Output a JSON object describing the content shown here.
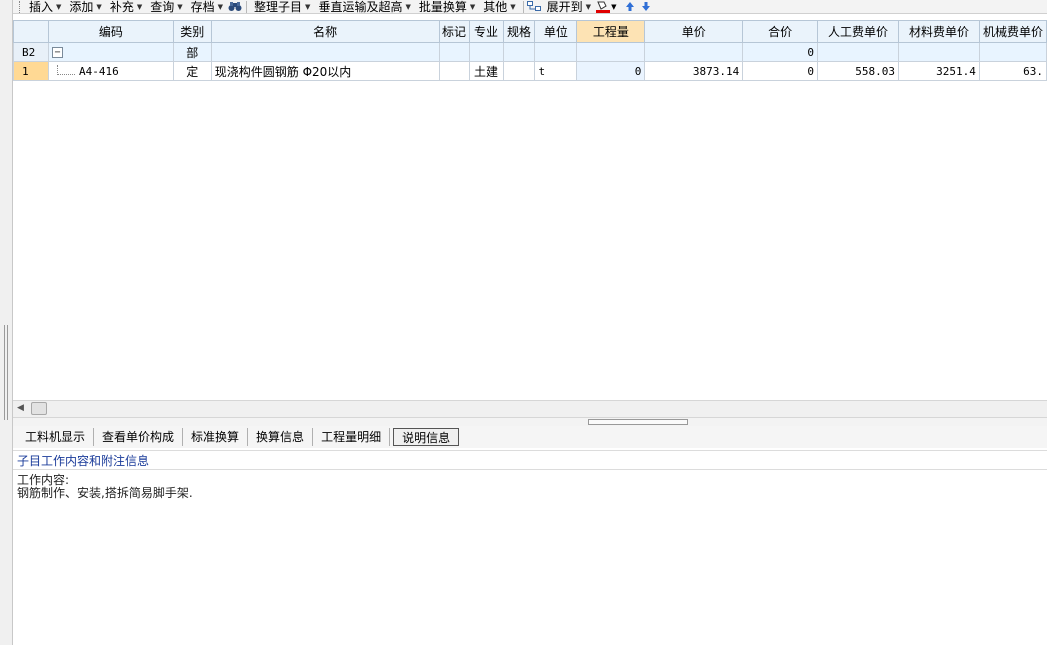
{
  "toolbar": {
    "items": [
      {
        "label": "插入",
        "dropdown": true
      },
      {
        "label": "添加",
        "dropdown": true
      },
      {
        "label": "补充",
        "dropdown": true
      },
      {
        "label": "查询",
        "dropdown": true
      },
      {
        "label": "存档",
        "dropdown": true
      }
    ],
    "find_icon": "binoculars-icon",
    "items2": [
      {
        "label": "整理子目",
        "dropdown": true
      },
      {
        "label": "垂直运输及超高",
        "dropdown": true
      },
      {
        "label": "批量换算",
        "dropdown": true
      },
      {
        "label": "其他",
        "dropdown": true
      }
    ],
    "expand_label": "展开到",
    "expand_icon": "expand-tree-icon",
    "color_icon": "paint-bucket-icon",
    "up_icon": "arrow-up-icon",
    "down_icon": "arrow-down-icon"
  },
  "grid": {
    "columns": [
      "",
      "编码",
      "类别",
      "名称",
      "标记",
      "专业",
      "规格",
      "单位",
      "工程量",
      "单价",
      "合价",
      "人工费单价",
      "材料费单价",
      "机械费单价"
    ],
    "rows": [
      {
        "rownum": "B2",
        "code": "",
        "type": "部",
        "name": "",
        "mark": "",
        "spec_major": "",
        "spec": "",
        "unit": "",
        "qty": "",
        "price": "",
        "total": "0",
        "labor": "",
        "material": "",
        "machine": ""
      },
      {
        "rownum": "1",
        "code": "A4-416",
        "type": "定",
        "name": "现浇构件圆钢筋 Φ20以内",
        "mark": "",
        "spec_major": "土建",
        "spec": "",
        "unit": "t",
        "qty": "0",
        "price": "3873.14",
        "total": "0",
        "labor": "558.03",
        "material": "3251.4",
        "machine": "63."
      }
    ]
  },
  "bottom_tabs": [
    "工料机显示",
    "查看单价构成",
    "标准换算",
    "换算信息",
    "工程量明细",
    "说明信息"
  ],
  "info": {
    "title": "子目工作内容和附注信息",
    "line1": "工作内容:",
    "line2": "钢筋制作、安装,搭拆简易脚手架."
  },
  "colors": {
    "header_bg": "#eaf3fb",
    "active_header": "#fde3b4",
    "info_title": "#1a3b9a"
  }
}
